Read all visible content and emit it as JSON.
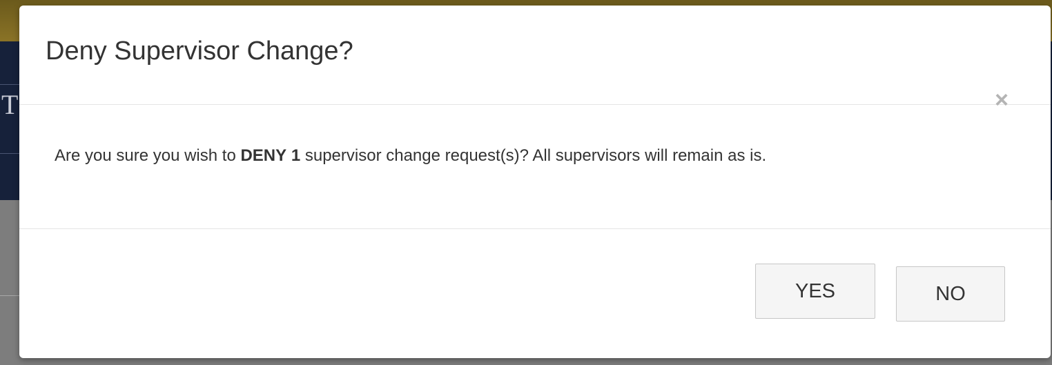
{
  "background": {
    "partial_letter": "T"
  },
  "dialog": {
    "title": "Deny Supervisor Change?",
    "close_glyph": "×",
    "message": {
      "prefix": "Are you sure you wish to ",
      "action": "DENY",
      "count": "1",
      "suffix": " supervisor change request(s)? All supervisors will remain as is."
    },
    "yes_label": "YES",
    "no_label": "NO"
  },
  "colors": {
    "header_gold": "#8a7326",
    "nav_navy": "#16213a",
    "overlay_gray": "#7d7d7d",
    "text": "#333333",
    "button_bg": "#f5f5f5",
    "close_icon": "#b4b4b4"
  }
}
